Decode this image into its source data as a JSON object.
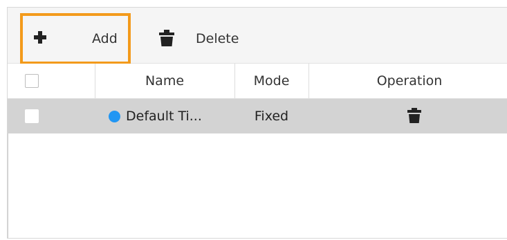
{
  "toolbar": {
    "add_label": "Add",
    "delete_label": "Delete",
    "add_icon": "plus-icon",
    "delete_icon": "trash-icon",
    "highlight_color": "#f39a1b"
  },
  "table": {
    "columns": [
      "Name",
      "Mode",
      "Operation"
    ],
    "rows": [
      {
        "name": "Default Ti...",
        "mode": "Fixed",
        "status_color": "#2196f3",
        "operation_icon": "trash-icon",
        "selected": true
      }
    ]
  }
}
